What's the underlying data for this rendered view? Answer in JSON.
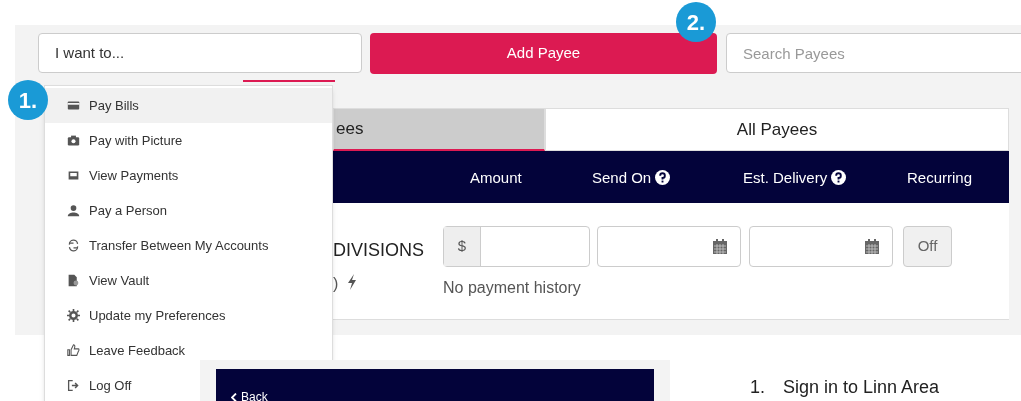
{
  "toolbar": {
    "action_field": {
      "value": "I want to..."
    },
    "add_button": "Add Payee",
    "search": {
      "placeholder": "Search Payees"
    }
  },
  "tabs": [
    {
      "label": "ees",
      "selected": true
    },
    {
      "label": "All Payees",
      "selected": false
    }
  ],
  "table": {
    "columns": [
      {
        "label": "Amount",
        "help": false
      },
      {
        "label": "Send On",
        "help": true
      },
      {
        "label": "Est. Delivery",
        "help": true
      },
      {
        "label": "Recurring",
        "help": false
      }
    ],
    "rows": [
      {
        "payee": "DIVISIONS",
        "payee_detail": ")",
        "currency": "$",
        "note": "No payment history",
        "recurring": "Off"
      }
    ]
  },
  "menu": {
    "items": [
      {
        "label": "Pay Bills",
        "selected": true
      },
      {
        "label": "Pay with Picture",
        "selected": false
      },
      {
        "label": "View Payments",
        "selected": false
      },
      {
        "label": "Pay a Person",
        "selected": false
      },
      {
        "label": "Transfer Between My Accounts",
        "selected": false
      },
      {
        "label": "View Vault",
        "selected": false
      },
      {
        "label": "Update my Preferences",
        "selected": false
      },
      {
        "label": "Leave Feedback",
        "selected": false
      },
      {
        "label": "Log Off",
        "selected": false
      }
    ]
  },
  "callouts": [
    {
      "label": "1."
    },
    {
      "label": "2."
    }
  ],
  "back_panel": {
    "back": "Back"
  },
  "steps": [
    {
      "number": "1.",
      "text": "Sign in to Linn Area"
    }
  ]
}
